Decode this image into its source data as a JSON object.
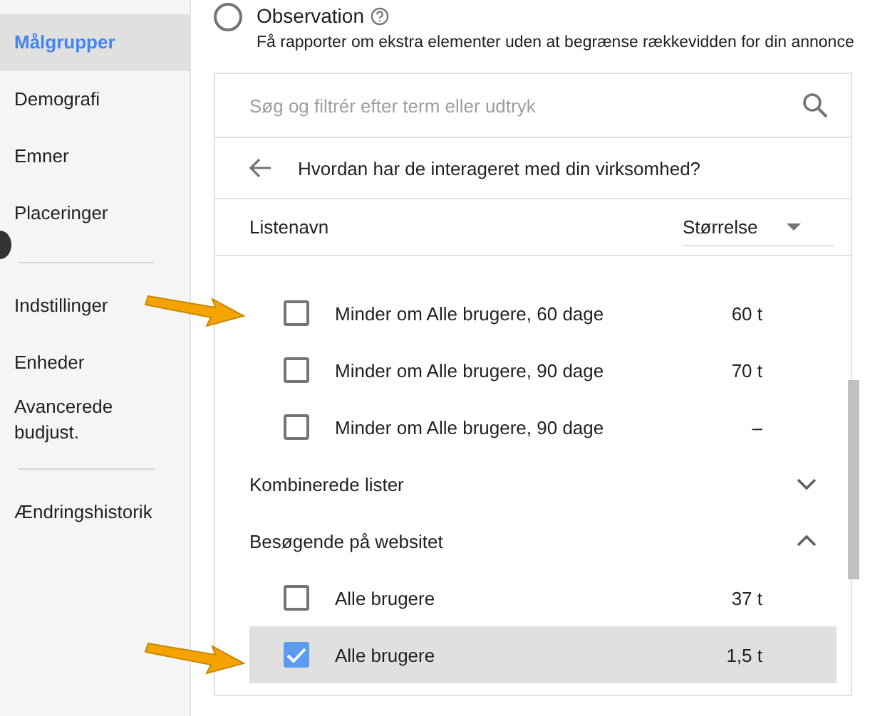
{
  "sidebar": {
    "groups": [
      [
        {
          "label": "Målgrupper",
          "selected": true
        },
        {
          "label": "Demografi",
          "selected": false
        },
        {
          "label": "Emner",
          "selected": false
        },
        {
          "label": "Placeringer",
          "selected": false
        }
      ],
      [
        {
          "label": "Indstillinger",
          "selected": false
        },
        {
          "label": "Enheder",
          "selected": false
        },
        {
          "label": "Avancerede budjust.",
          "selected": false
        }
      ],
      [
        {
          "label": "Ændringshistorik",
          "selected": false
        }
      ]
    ]
  },
  "observation": {
    "title": "Observation",
    "description": "Få rapporter om ekstra elementer uden at begrænse rækkevidden for din annonce",
    "selected": false
  },
  "search": {
    "placeholder": "Søg og filtrér efter term eller udtryk"
  },
  "back_row": {
    "title": "Hvordan har de interageret med din virksomhed?"
  },
  "columns": [
    "Listenavn",
    "Størrelse"
  ],
  "list": [
    {
      "kind": "row",
      "name": "Minder om Alle brugere, 60 dage",
      "size": "60 t",
      "checked": false,
      "selected": false
    },
    {
      "kind": "row",
      "name": "Minder om Alle brugere, 90 dage",
      "size": "70 t",
      "checked": false,
      "selected": false
    },
    {
      "kind": "row",
      "name": "Minder om Alle brugere, 90 dage",
      "size": "–",
      "checked": false,
      "selected": false
    },
    {
      "kind": "section",
      "title": "Kombinerede lister",
      "expanded": false
    },
    {
      "kind": "section",
      "title": "Besøgende på websitet",
      "expanded": true
    },
    {
      "kind": "row",
      "name": "Alle brugere",
      "size": "37 t",
      "checked": false,
      "selected": false
    },
    {
      "kind": "row",
      "name": "Alle brugere",
      "size": "1,5 t",
      "checked": true,
      "selected": true
    }
  ]
}
